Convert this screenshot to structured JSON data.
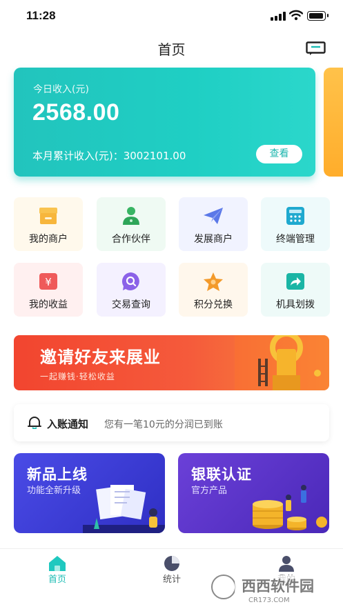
{
  "status_bar": {
    "time": "11:28"
  },
  "header": {
    "title": "首页",
    "message_icon": "message-icon"
  },
  "income_card": {
    "today_label": "今日收入(元)",
    "today_amount": "2568.00",
    "month_label": "本月累计收入(元)：3002101.00",
    "view_button": "查看"
  },
  "grid": [
    {
      "label": "我的商户",
      "icon": "store-icon",
      "bg": "#fff9ec",
      "color": "#f7b63c"
    },
    {
      "label": "合作伙伴",
      "icon": "partner-icon",
      "bg": "#effaf3",
      "color": "#38b463"
    },
    {
      "label": "发展商户",
      "icon": "paper-plane-icon",
      "bg": "#f1f3ff",
      "color": "#5b78e8"
    },
    {
      "label": "终端管理",
      "icon": "terminal-icon",
      "bg": "#eefafb",
      "color": "#1fa9cf"
    },
    {
      "label": "我的收益",
      "icon": "yen-icon",
      "bg": "#fff0f0",
      "color": "#ef5a5a"
    },
    {
      "label": "交易查询",
      "icon": "search-chat-icon",
      "bg": "#f4f1ff",
      "color": "#8b62e8"
    },
    {
      "label": "积分兑换",
      "icon": "star-icon",
      "bg": "#fff7ec",
      "color": "#f39a2b"
    },
    {
      "label": "机具划拨",
      "icon": "share-icon",
      "bg": "#eefaf8",
      "color": "#1bb5a5"
    }
  ],
  "banner": {
    "title": "邀请好友来展业",
    "subtitle": "一起赚钱·轻松收益"
  },
  "notice": {
    "title": "入账通知",
    "text": "您有一笔10元的分润已到账"
  },
  "promos": [
    {
      "title": "新品上线",
      "subtitle": "功能全新升级"
    },
    {
      "title": "银联认证",
      "subtitle": "官方产品"
    }
  ],
  "tabbar": [
    {
      "label": "首页",
      "icon": "home-icon",
      "active": true
    },
    {
      "label": "统计",
      "icon": "pie-chart-icon",
      "active": false
    },
    {
      "label": "我的",
      "icon": "user-icon",
      "active": false
    }
  ],
  "watermark": {
    "text": "西西软件园",
    "sub": "CR173.COM"
  },
  "colors": {
    "accent": "#1fc8bf",
    "banner": "#f2452f",
    "promo_blue": "#3d3fd6",
    "promo_purple": "#6a3fd6"
  }
}
